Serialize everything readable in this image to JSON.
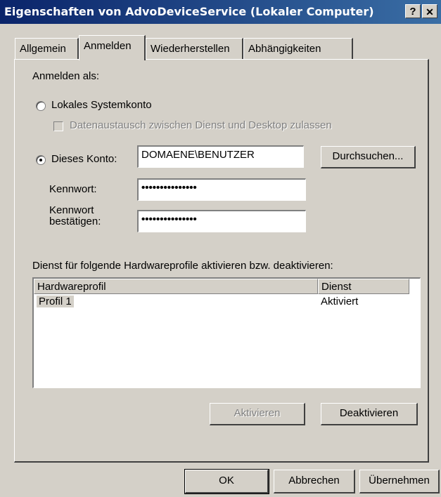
{
  "window": {
    "title": "Eigenschaften von AdvoDeviceService (Lokaler Computer)",
    "help_label": "?",
    "close_label": "✕"
  },
  "tabs": [
    {
      "label": "Allgemein"
    },
    {
      "label": "Anmelden"
    },
    {
      "label": "Wiederherstellen"
    },
    {
      "label": "Abhängigkeiten"
    }
  ],
  "logon": {
    "heading": "Anmelden als:",
    "local_system_label": "Lokales Systemkonto",
    "desktop_interact_label": "Datenaustausch zwischen Dienst und Desktop zulassen",
    "this_account_label": "Dieses Konto:",
    "account_value": "DOMAENE\\BENUTZER",
    "browse_label": "Durchsuchen...",
    "password_label": "Kennwort:",
    "password_value": "•••••••••••••••",
    "confirm_label_line1": "Kennwort",
    "confirm_label_line2": "bestätigen:",
    "confirm_value": "•••••••••••••••",
    "selected_option": "this_account"
  },
  "profiles": {
    "heading": "Dienst für folgende Hardwareprofile aktivieren bzw. deaktivieren:",
    "columns": [
      "Hardwareprofil",
      "Dienst"
    ],
    "rows": [
      {
        "profile": "Profil 1",
        "service": "Aktiviert"
      }
    ],
    "enable_label": "Aktivieren",
    "disable_label": "Deaktivieren"
  },
  "footer": {
    "ok_label": "OK",
    "cancel_label": "Abbrechen",
    "apply_label": "Übernehmen"
  }
}
